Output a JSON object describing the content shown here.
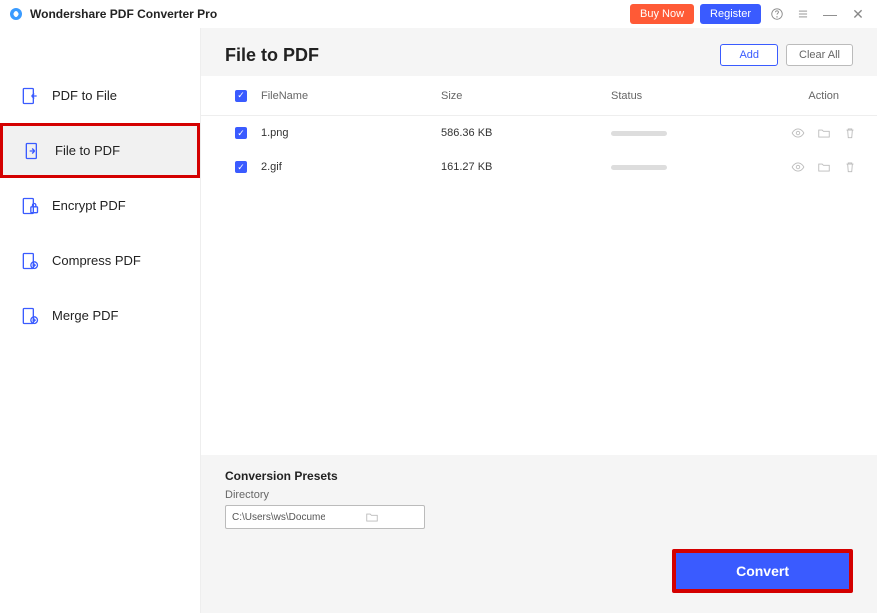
{
  "app": {
    "title": "Wondershare PDF Converter Pro"
  },
  "titlebar": {
    "buy": "Buy Now",
    "register": "Register"
  },
  "sidebar": {
    "items": [
      {
        "label": "PDF to File"
      },
      {
        "label": "File to PDF"
      },
      {
        "label": "Encrypt PDF"
      },
      {
        "label": "Compress PDF"
      },
      {
        "label": "Merge PDF"
      }
    ]
  },
  "content": {
    "title": "File to PDF",
    "add": "Add",
    "clear": "Clear All",
    "columns": {
      "name": "FileName",
      "size": "Size",
      "status": "Status",
      "action": "Action"
    },
    "rows": [
      {
        "name": "1.png",
        "size": "586.36 KB"
      },
      {
        "name": "2.gif",
        "size": "161.27 KB"
      }
    ]
  },
  "footer": {
    "presets": "Conversion Presets",
    "dir_label": "Directory",
    "dir_value": "C:\\Users\\ws\\Documents\\PDFConvert",
    "convert": "Convert"
  }
}
